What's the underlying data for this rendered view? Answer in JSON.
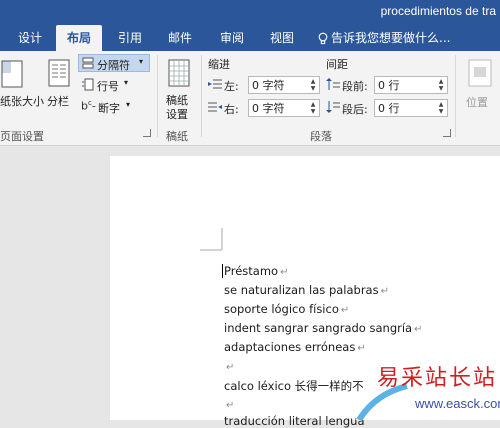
{
  "titlebar": {
    "doc_title": "procedimientos de tra"
  },
  "tabs": [
    {
      "label": "设计",
      "active": false
    },
    {
      "label": "布局",
      "active": true
    },
    {
      "label": "引用",
      "active": false
    },
    {
      "label": "邮件",
      "active": false
    },
    {
      "label": "审阅",
      "active": false
    },
    {
      "label": "视图",
      "active": false
    }
  ],
  "tell_me": {
    "label": "告诉我您想要做什么..."
  },
  "ribbon": {
    "page_setup": {
      "size_label": "纸张大小",
      "columns_label": "分栏",
      "breaks_label": "分隔符",
      "line_numbers_label": "行号",
      "hyphenation_label": "断字",
      "group_label": "页面设置"
    },
    "draft_paper": {
      "button_label_1": "稿纸",
      "button_label_2": "设置",
      "group_label": "稿纸"
    },
    "paragraph": {
      "indent_header": "缩进",
      "spacing_header": "间距",
      "left_label": "左:",
      "right_label": "右:",
      "left_value": "0 字符",
      "right_value": "0 字符",
      "before_label": "段前:",
      "after_label": "段后:",
      "before_value": "0 行",
      "after_value": "0 行",
      "group_label": "段落"
    },
    "arrange": {
      "position_label": "位置"
    }
  },
  "document": {
    "lines": [
      "Préstamo",
      "se naturalizan las palabras",
      "soporte lógico físico",
      "indent sangrar sangrado sangría",
      "adaptaciones erróneas",
      "",
      "calco léxico  长得一样的不",
      "",
      "traducción literal lengua"
    ]
  },
  "watermark": {
    "cn_text": "易采站长站",
    "url_text": "www.easck.com"
  },
  "colors": {
    "titlebar": "#2b579a",
    "ribbon": "#f3f3f3",
    "canvas": "#e6e6e6"
  }
}
